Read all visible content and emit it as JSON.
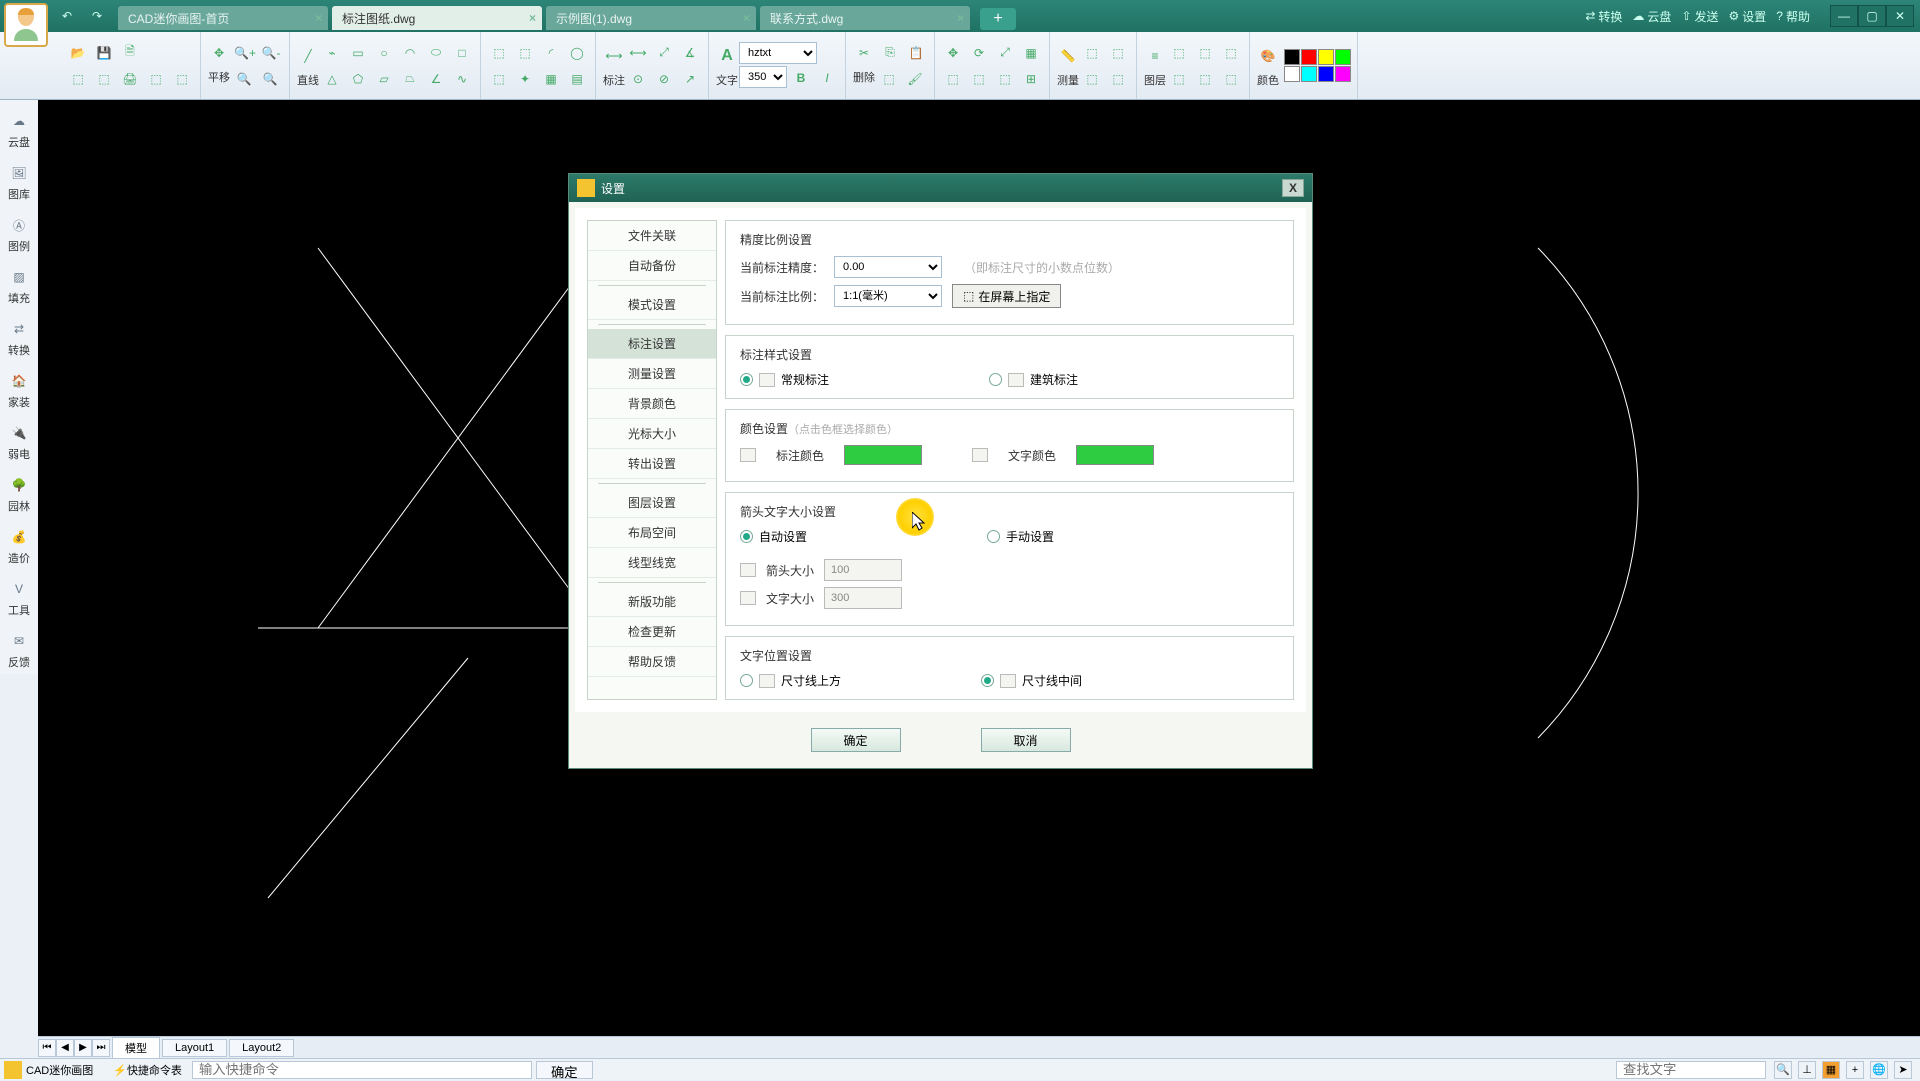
{
  "titlebar": {
    "tabs": [
      {
        "label": "CAD迷你画图-首页"
      },
      {
        "label": "标注图纸.dwg"
      },
      {
        "label": "示例图(1).dwg"
      },
      {
        "label": "联系方式.dwg"
      }
    ],
    "right": {
      "convert": "转换",
      "cloud": "云盘",
      "send": "发送",
      "settings": "设置",
      "help": "帮助"
    }
  },
  "ribbon": {
    "move": "平移",
    "line": "直线",
    "annotate": "标注",
    "text": "文字",
    "font": "hztxt",
    "size": "350",
    "erase": "删除",
    "measure": "测量",
    "layer": "图层",
    "color": "颜色",
    "palette": [
      "#000000",
      "#ff0000",
      "#ffff00",
      "#00ff00",
      "#ffffff",
      "#00ffff",
      "#0000ff",
      "#ff00ff"
    ]
  },
  "leftbar": [
    {
      "label": "云盘"
    },
    {
      "label": "图库"
    },
    {
      "label": "图例"
    },
    {
      "label": "填充"
    },
    {
      "label": "转换"
    },
    {
      "label": "家装"
    },
    {
      "label": "弱电"
    },
    {
      "label": "园林"
    },
    {
      "label": "造价"
    },
    {
      "label": "工具"
    },
    {
      "label": "反馈"
    }
  ],
  "bottom": {
    "tabs": [
      "模型",
      "Layout1",
      "Layout2"
    ]
  },
  "status": {
    "appname": "CAD迷你画图",
    "cmdlabel": "快捷命令表",
    "cmdplaceholder": "输入快捷命令",
    "ok": "确定",
    "searchplaceholder": "查找文字"
  },
  "dialog": {
    "title": "设置",
    "nav": [
      "文件关联",
      "自动备份",
      "模式设置",
      "标注设置",
      "测量设置",
      "背景颜色",
      "光标大小",
      "转出设置",
      "图层设置",
      "布局空间",
      "线型线宽",
      "新版功能",
      "检查更新",
      "帮助反馈"
    ],
    "nav_active_index": 3,
    "section1": {
      "title": "精度比例设置",
      "precision_label": "当前标注精度：",
      "precision_value": "0.00",
      "precision_hint": "（即标注尺寸的小数点位数）",
      "scale_label": "当前标注比例：",
      "scale_value": "1:1(毫米)",
      "screen_btn": "在屏幕上指定"
    },
    "section2": {
      "title": "标注样式设置",
      "opt1": "常规标注",
      "opt2": "建筑标注"
    },
    "section3": {
      "title": "颜色设置",
      "hint": "（点击色框选择颜色）",
      "label1": "标注颜色",
      "color1": "#2ecc40",
      "label2": "文字颜色",
      "color2": "#2ecc40"
    },
    "section4": {
      "title": "箭头文字大小设置",
      "opt1": "自动设置",
      "opt2": "手动设置",
      "arrow_label": "箭头大小",
      "arrow_value": "100",
      "text_label": "文字大小",
      "text_value": "300"
    },
    "section5": {
      "title": "文字位置设置",
      "opt1": "尺寸线上方",
      "opt2": "尺寸线中间"
    },
    "ok": "确定",
    "cancel": "取消"
  }
}
